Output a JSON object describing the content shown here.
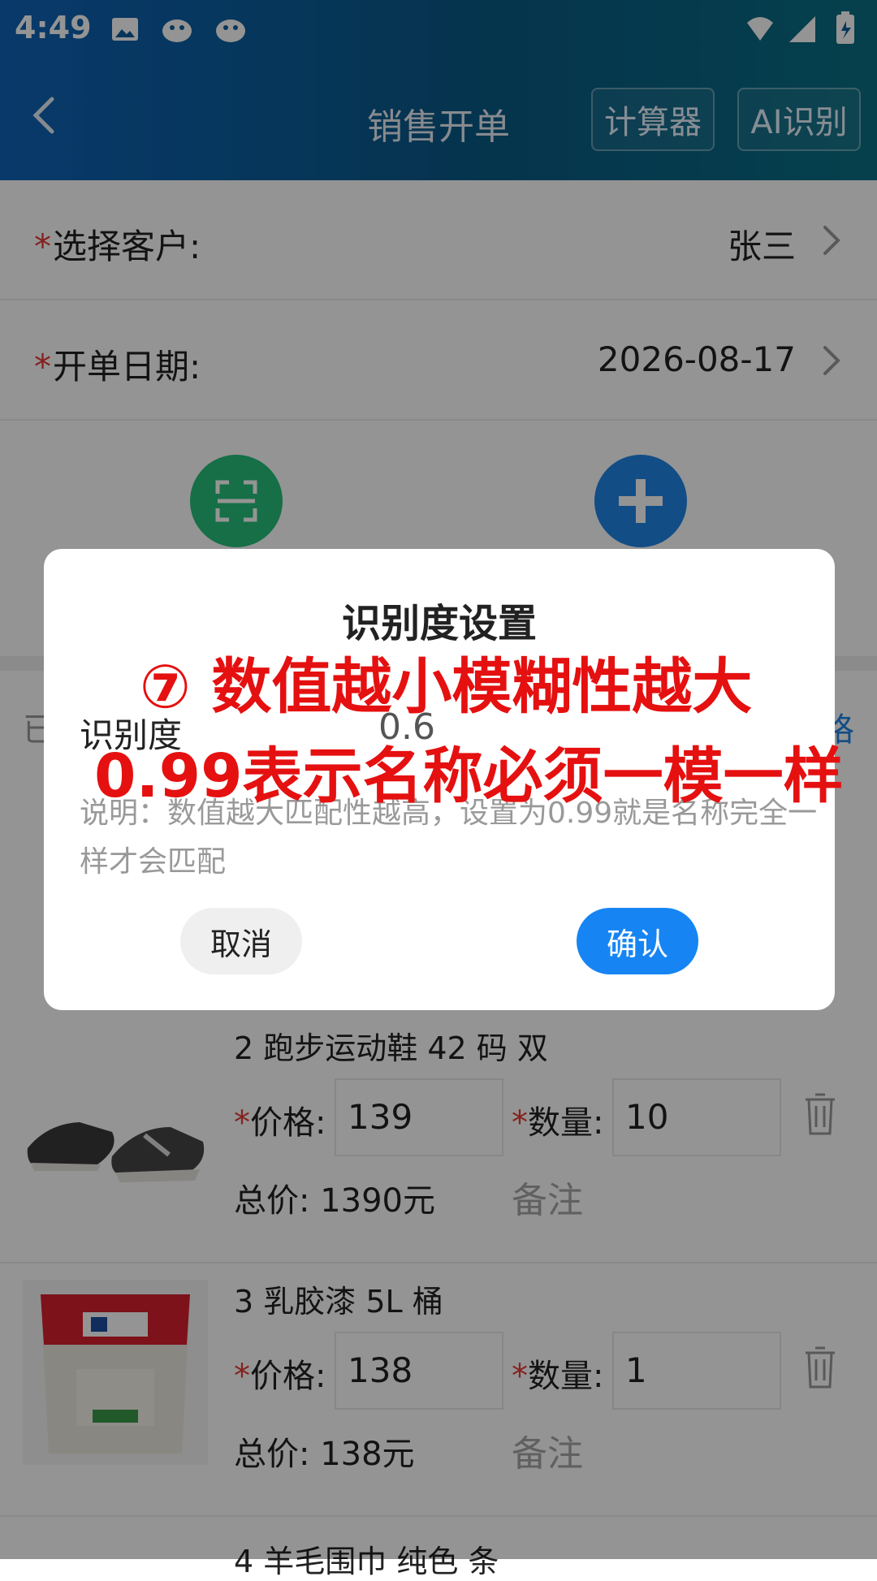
{
  "status_bar": {
    "time": "4:49"
  },
  "header": {
    "title": "销售开单",
    "calc_button": "计算器",
    "ai_button": "AI识别"
  },
  "form": {
    "customer_label": "选择客户:",
    "customer_value": "张三",
    "date_label": "开单日期:",
    "date_value": "2026-08-17"
  },
  "list_header": {
    "left": "已",
    "right": "格"
  },
  "items": [
    {
      "name": "2 跑步运动鞋 42 码 双",
      "price_label": "价格:",
      "price": "139",
      "qty_label": "数量:",
      "qty": "10",
      "total": "总价: 1390元",
      "remark_placeholder": "备注"
    },
    {
      "name": "3 乳胶漆 5L 桶",
      "price_label": "价格:",
      "price": "138",
      "qty_label": "数量:",
      "qty": "1",
      "total": "总价: 138元",
      "remark_placeholder": "备注"
    }
  ],
  "peek_item": "4 羊毛围巾 纯色 条",
  "dialog": {
    "title": "识别度设置",
    "label": "识别度",
    "value": "0.6",
    "note": "说明：数值越大匹配性越高，设置为0.99就是名称完全一样才会匹配",
    "cancel": "取消",
    "confirm": "确认"
  },
  "annotations": {
    "line1": "⑦ 数值越小模糊性越大",
    "line2": "0.99表示名称必须一模一样"
  },
  "icons": [
    "image-icon",
    "app-icon",
    "back-icon",
    "chevron-right-icon",
    "scan-icon",
    "add-icon",
    "trash-icon",
    "wifi-icon",
    "signal-icon",
    "battery-icon"
  ],
  "colors": {
    "header_start": "#0e63b8",
    "header_end": "#0a6f84",
    "accent": "#1685f3",
    "required": "#e53935",
    "annotation": "#e51010"
  }
}
